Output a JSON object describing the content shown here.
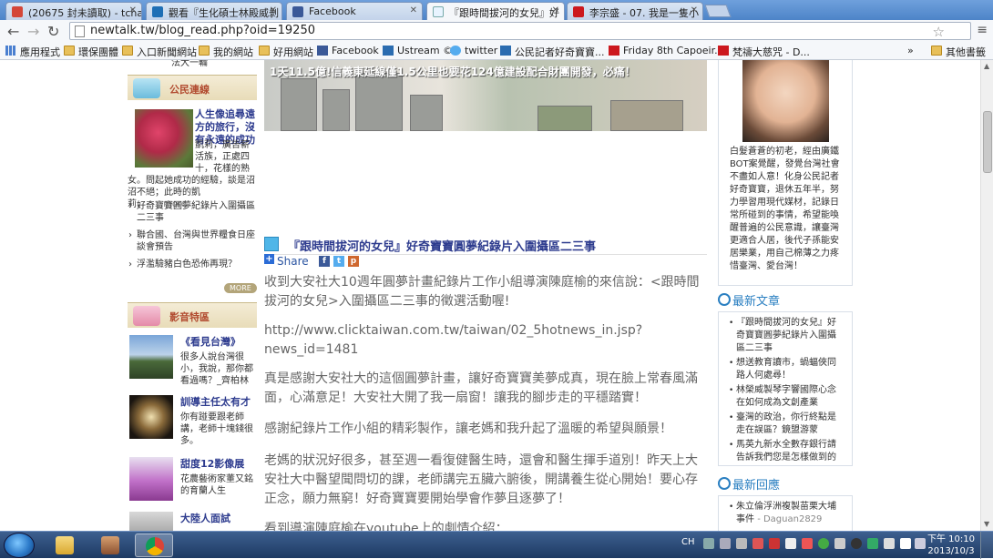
{
  "tabs": [
    {
      "label": "(20675 封未讀取) - tchan",
      "color": "#d44638"
    },
    {
      "label": "觀看『生化碩士林殿威剝",
      "color": "#1f6fb5"
    },
    {
      "label": "Facebook",
      "color": "#3b5998"
    },
    {
      "label": "『跟時間拔河的女兒』好",
      "color": "#e8f4ff"
    },
    {
      "label": "李宗盛 - 07. 我是一隻小",
      "color": "#cc181e"
    }
  ],
  "address_bar": {
    "url": "newtalk.tw/blog_read.php?oid=19250"
  },
  "bookmarks": [
    {
      "label": "應用程式",
      "kind": "apps"
    },
    {
      "label": "環保團體",
      "kind": "folder"
    },
    {
      "label": "入口新聞網站",
      "kind": "folder"
    },
    {
      "label": "我的網站",
      "kind": "folder"
    },
    {
      "label": "好用網站",
      "kind": "folder"
    },
    {
      "label": "Facebook",
      "kind": "facebook"
    },
    {
      "label": "Ustream ©",
      "kind": "ustream"
    },
    {
      "label": "twitter",
      "kind": "twitter"
    },
    {
      "label": "公民記者好奇寶寶...",
      "kind": "ustream"
    },
    {
      "label": "Friday 8th Capoeir...",
      "kind": "youtube"
    },
    {
      "label": "梵禱大慈咒 - D...",
      "kind": "youtube"
    },
    {
      "label": "»",
      "kind": "more"
    },
    {
      "label": "其他書籤",
      "kind": "folder"
    }
  ],
  "left": {
    "top_fragment": "法大一輪",
    "citizen": {
      "title": "公民連線",
      "feature_title": "人生像追尋遠方的旅行，沒有永遠的成功",
      "feature_text_a": "凱莉，廣告薪活族，正處四十，花樣的熟",
      "feature_text_b": "女。問起她成功的經驗，談是沼沼不絕；此時的凱莉，",
      "more_link": "......more",
      "items": [
        "好奇寶寶圓夢紀錄片入圍攝區二三事",
        "聯合國、台灣與世界糧食日座談會預告",
        "浮濫驗豬白色恐佈再現？"
      ],
      "more_btn": "MORE"
    },
    "video": {
      "title": "影音特區",
      "items": [
        {
          "title": "《看見台灣》",
          "text": "很多人說台灣很小，我說，那你都看過嗎？_齊柏林"
        },
        {
          "title": "訓導主任太有才",
          "text": "你有踫要跟老師講，老師十塊錢很多。"
        },
        {
          "title": "甜度12影像展",
          "text": "花農藝術家董又銘的育蘭人生"
        },
        {
          "title": "大陸人面試",
          "text": ""
        }
      ]
    }
  },
  "center": {
    "banner_title": "1天11.5億!信義東延線僅1.5公里也要花124億建設配合財團開發，必痛！",
    "post_title": "『跟時間拔河的女兒』好奇寶寶圓夢紀錄片入圍攝區二三事",
    "share_label": "Share",
    "paragraphs": [
      "收到大安社大10週年圓夢計畫紀錄片工作小組導演陳庭榆的來信說：<跟時間拔河的女兒>入圍攝區二三事的徵選活動喔!",
      "http://www.clicktaiwan.com.tw/taiwan/02_5hotnews_in.jsp?news_id=1481",
      "真是感謝大安社大的這個圓夢計畫，讓好奇寶寶美夢成真，現在臉上常春風滿面，心滿意足！大安社大開了我一扇窗！讓我的腳步走的平穩踏實！",
      "感謝紀錄片工作小組的精彩製作，讓老媽和我升起了溫暖的希望與願景！",
      "老媽的狀況好很多，甚至週一看復健醫生時，還會和醫生揮手道別！昨天上大安社大中醫望聞問切的課，老師講完五臟六腑後，開講養生從心開始！要心存正念，願力無窮！好奇寶寶要開始學會作夢且逐夢了！",
      "看到導演陳庭榆在youtube上的劇情介紹："
    ]
  },
  "right": {
    "profile_text": "白髮蒼蒼的初老，經由廣鐵BOT案覺醒，發覺台灣社會不盡如人意！化身公民記者好奇寶寶，退休五年半，努力學習用現代媒材，記錄日常所碰到的事情，希望能喚醒普遍的公民意識，讓臺灣更適合人居，後代子孫能安居樂業，用自己棉薄之力疼惜臺灣、愛台灣！",
    "latest_articles": {
      "title": "最新文章",
      "items": [
        "『跟時間拔河的女兒』好奇寶寶圓夢紀錄片入圍攝區二三事",
        "想送教育讀市，蝸蝠俠同路人何處尋！",
        "林榮威製琴字響國際心念在如何成為文創產業",
        "臺灣的政治，你行終點是走在誤區？鏡盟游蒙",
        "馬英九新水全數存銀行請告訴我們您是怎樣做到的"
      ]
    },
    "latest_replies": {
      "title": "最新回應",
      "items": [
        {
          "text": "朱立倫浮洲複製苗栗大埔事件",
          "author": "- Daguan2829"
        }
      ]
    }
  },
  "taskbar": {
    "lang": "CH",
    "time": "下午 10:10",
    "date": "2013/10/3"
  }
}
